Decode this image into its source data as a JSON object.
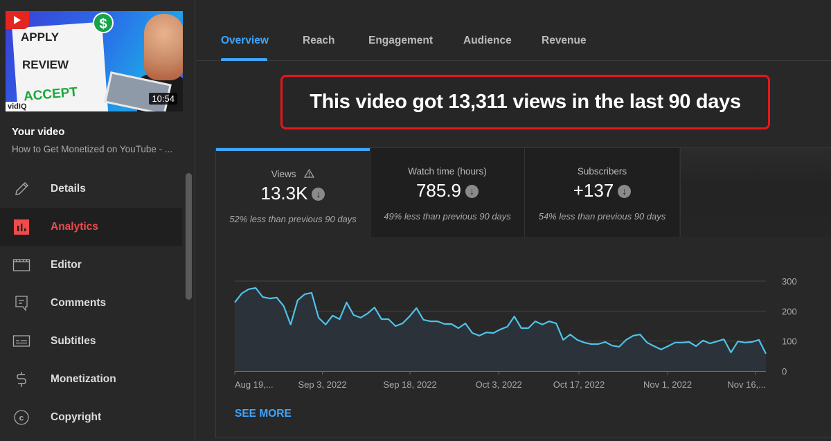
{
  "sidebar": {
    "thumbnail": {
      "words": [
        "APPLY",
        "REVIEW",
        "ACCEPT"
      ],
      "badge": "vidIQ",
      "duration": "10:54",
      "dollar_glyph": "$"
    },
    "your_video_label": "Your video",
    "video_title": "How to Get Monetized on YouTube - ...",
    "items": [
      {
        "label": "Details",
        "icon": "pencil-icon",
        "active": false
      },
      {
        "label": "Analytics",
        "icon": "analytics-icon",
        "active": true
      },
      {
        "label": "Editor",
        "icon": "clapperboard-icon",
        "active": false
      },
      {
        "label": "Comments",
        "icon": "comment-icon",
        "active": false
      },
      {
        "label": "Subtitles",
        "icon": "subtitles-icon",
        "active": false
      },
      {
        "label": "Monetization",
        "icon": "dollar-icon",
        "active": false
      },
      {
        "label": "Copyright",
        "icon": "copyright-icon",
        "active": false
      }
    ],
    "active_color": "#ef4b4b"
  },
  "tabs": [
    {
      "label": "Overview",
      "active": true
    },
    {
      "label": "Reach",
      "active": false
    },
    {
      "label": "Engagement",
      "active": false
    },
    {
      "label": "Audience",
      "active": false
    },
    {
      "label": "Revenue",
      "active": false
    }
  ],
  "callout": {
    "text": "This video got 13,311 views in the last 90 days",
    "border_color": "#e8161c"
  },
  "metrics": [
    {
      "label": "Views",
      "value": "13.3K",
      "note": "52% less than previous 90 days",
      "trend": "down",
      "warning": true,
      "selected": true
    },
    {
      "label": "Watch time (hours)",
      "value": "785.9",
      "note": "49% less than previous 90 days",
      "trend": "down",
      "warning": false,
      "selected": false
    },
    {
      "label": "Subscribers",
      "value": "+137",
      "note": "54% less than previous 90 days",
      "trend": "down",
      "warning": false,
      "selected": false
    }
  ],
  "see_more_label": "SEE MORE",
  "accent_color": "#3ea6ff",
  "chart_data": {
    "type": "area",
    "title": "",
    "xlabel": "",
    "ylabel": "Views",
    "series": [
      {
        "name": "Views",
        "color": "#4fc3e8",
        "values": [
          229,
          259,
          273,
          277,
          247,
          242,
          245,
          217,
          155,
          236,
          256,
          261,
          178,
          155,
          185,
          173,
          229,
          187,
          178,
          192,
          212,
          173,
          173,
          150,
          159,
          182,
          210,
          171,
          166,
          166,
          157,
          157,
          143,
          159,
          127,
          118,
          129,
          127,
          139,
          148,
          182,
          143,
          143,
          166,
          155,
          166,
          159,
          104,
          122,
          104,
          95,
          90,
          90,
          97,
          85,
          81,
          104,
          118,
          122,
          95,
          83,
          72,
          83,
          95,
          95,
          97,
          83,
          102,
          92,
          99,
          106,
          62,
          99,
          95,
          97,
          104,
          58
        ]
      }
    ],
    "x_tick_labels": [
      "Aug 19,...",
      "Sep 3, 2022",
      "Sep 18, 2022",
      "Oct 3, 2022",
      "Oct 17, 2022",
      "Nov 1, 2022",
      "Nov 16,..."
    ],
    "x_tick_fractions": [
      0.0,
      0.165,
      0.33,
      0.497,
      0.648,
      0.815,
      0.98
    ],
    "y_ticks": [
      0,
      100,
      200,
      300
    ],
    "ylim": [
      0,
      300
    ],
    "grid": true,
    "y_axis_side": "right"
  }
}
